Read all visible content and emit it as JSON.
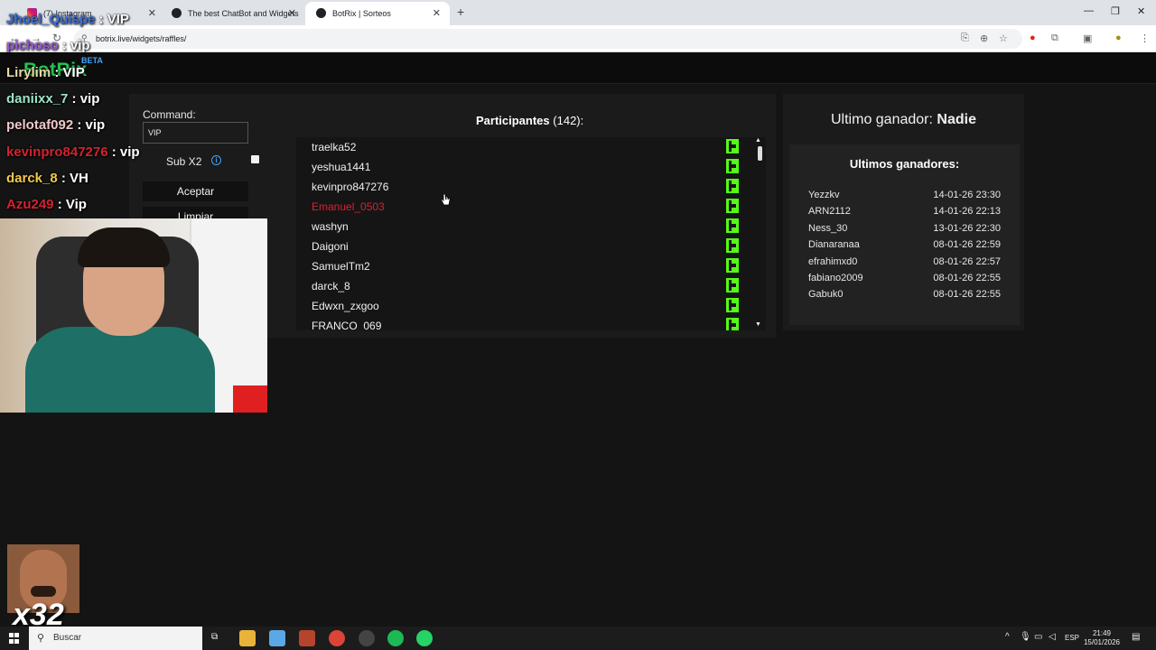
{
  "browser": {
    "tabs": [
      {
        "title": "(7) Instagram",
        "active": false
      },
      {
        "title": "The best ChatBot and Widgets",
        "active": false
      },
      {
        "title": "BotRix | Sorteos",
        "active": true
      }
    ],
    "url": "botrix.live/widgets/raffles/"
  },
  "app": {
    "logo": "BotRix",
    "beta": "BETA"
  },
  "raffle": {
    "command_label": "Command:",
    "command_value": "VIP",
    "sub_label": "Sub X2",
    "accept_label": "Aceptar",
    "clear_label": "Limpiar",
    "participants_label": "Participantes",
    "participants_count": "(142):",
    "participants": [
      {
        "name": "traelka52",
        "highlight": false
      },
      {
        "name": "yeshua1441",
        "highlight": false
      },
      {
        "name": "kevinpro847276",
        "highlight": false
      },
      {
        "name": "Emanuel_0503",
        "highlight": true
      },
      {
        "name": "washyn",
        "highlight": false
      },
      {
        "name": "Daigoni",
        "highlight": false
      },
      {
        "name": "SamuelTm2",
        "highlight": false
      },
      {
        "name": "darck_8",
        "highlight": false
      },
      {
        "name": "Edwxn_zxgoo",
        "highlight": false
      },
      {
        "name": "FRANCO_069",
        "highlight": false
      }
    ]
  },
  "winners": {
    "last_label": "Ultimo ganador:",
    "last_value": "Nadie",
    "list_title": "Ultimos ganadores:",
    "list": [
      {
        "name": "Yezzkv",
        "date": "14-01-26 23:30"
      },
      {
        "name": "ARN2112",
        "date": "14-01-26 22:13"
      },
      {
        "name": "Ness_30",
        "date": "13-01-26 22:30"
      },
      {
        "name": "Dianaranaa",
        "date": "08-01-26 22:59"
      },
      {
        "name": "efrahimxd0",
        "date": "08-01-26 22:57"
      },
      {
        "name": "fabiano2009",
        "date": "08-01-26 22:55"
      },
      {
        "name": "Gabuk0",
        "date": "08-01-26 22:55"
      }
    ]
  },
  "stream_chat": [
    {
      "user": "Jhoel_Quispe",
      "msg": ": VIP",
      "color": "#3b6fe0"
    },
    {
      "user": "pichoso",
      "msg": ": vip",
      "color": "#9b59d6"
    },
    {
      "user": "Lirylim",
      "msg": ": VIP",
      "color": "#e8d9a8"
    },
    {
      "user": "daniixx_7",
      "msg": ": vip",
      "color": "#9fe3c8"
    },
    {
      "user": "pelotaf092",
      "msg": ": vip",
      "color": "#f0c8c8"
    },
    {
      "user": "kevinpro847276",
      "msg": ": vip",
      "color": "#d4232f"
    },
    {
      "user": "darck_8",
      "msg": ": VH",
      "color": "#f2c94c"
    },
    {
      "user": "Azu249",
      "msg": ": Vip",
      "color": "#d4232f"
    }
  ],
  "overlay": {
    "multiplier": "x32"
  },
  "taskbar": {
    "search": "Buscar",
    "lang": "ESP",
    "time": "21:49",
    "date": "15/01/2026"
  },
  "colors": {
    "kick_green": "#53fc18",
    "brand_green": "#23c552",
    "highlight_red": "#d4232f"
  }
}
